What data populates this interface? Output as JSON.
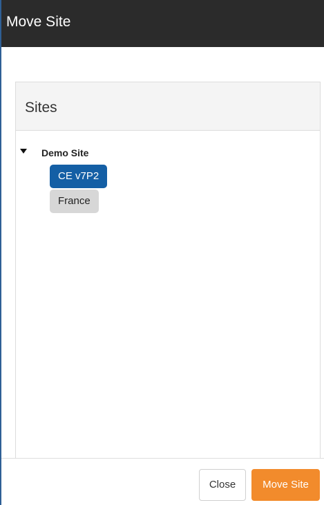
{
  "modal": {
    "title": "Move Site"
  },
  "panel": {
    "title": "Sites"
  },
  "tree": {
    "root": {
      "label": "Demo Site",
      "expanded": true,
      "caret_icon": "caret-down-icon"
    },
    "children": [
      {
        "label": "CE v7P2",
        "selected": true
      },
      {
        "label": "France",
        "selected": false
      }
    ]
  },
  "footer": {
    "close_label": "Close",
    "move_label": "Move Site"
  },
  "colors": {
    "header_bg": "#2b2b2b",
    "selected_node": "#145fa5",
    "unselected_node": "#d7d7d7",
    "primary_button": "#f28b2c"
  }
}
